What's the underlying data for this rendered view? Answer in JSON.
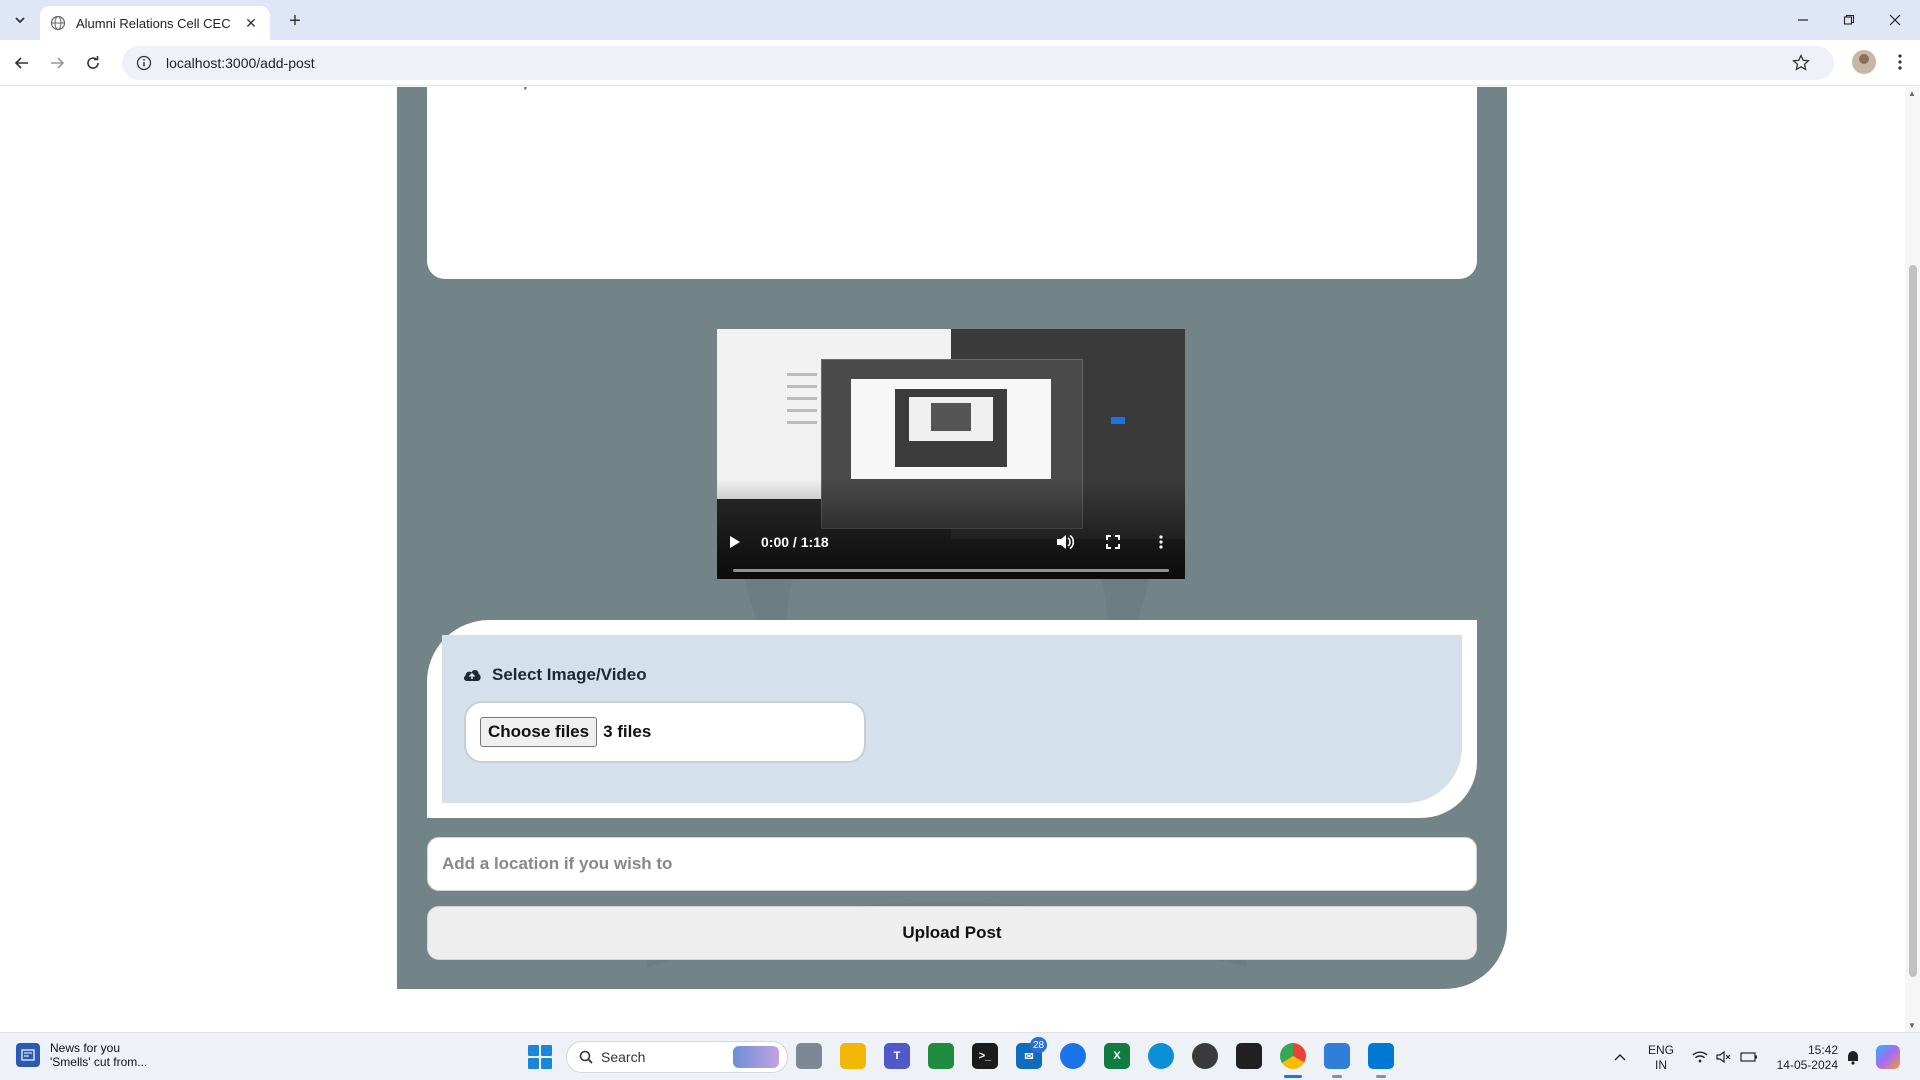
{
  "browser": {
    "tab_title": "Alumni Relations Cell CEC",
    "url": "localhost:3000/add-post"
  },
  "form": {
    "caption_placeholder": "Write a caption...",
    "video_time": "0:00 / 1:18",
    "upload_label": "Select Image/Video",
    "choose_files_label": "Choose files",
    "file_count": "3 files",
    "location_placeholder": "Add a location if you wish to",
    "upload_button": "Upload Post"
  },
  "taskbar": {
    "news_title": "News for you",
    "news_subtitle": "'Smells' cut from...",
    "search_label": "Search",
    "mail_badge": "28",
    "lang_top": "ENG",
    "lang_bottom": "IN",
    "time": "15:42",
    "date": "14-05-2024"
  },
  "colors": {
    "panel": "#738489",
    "upload_inner": "#d4e0ea",
    "accent": "#1a73e8"
  }
}
